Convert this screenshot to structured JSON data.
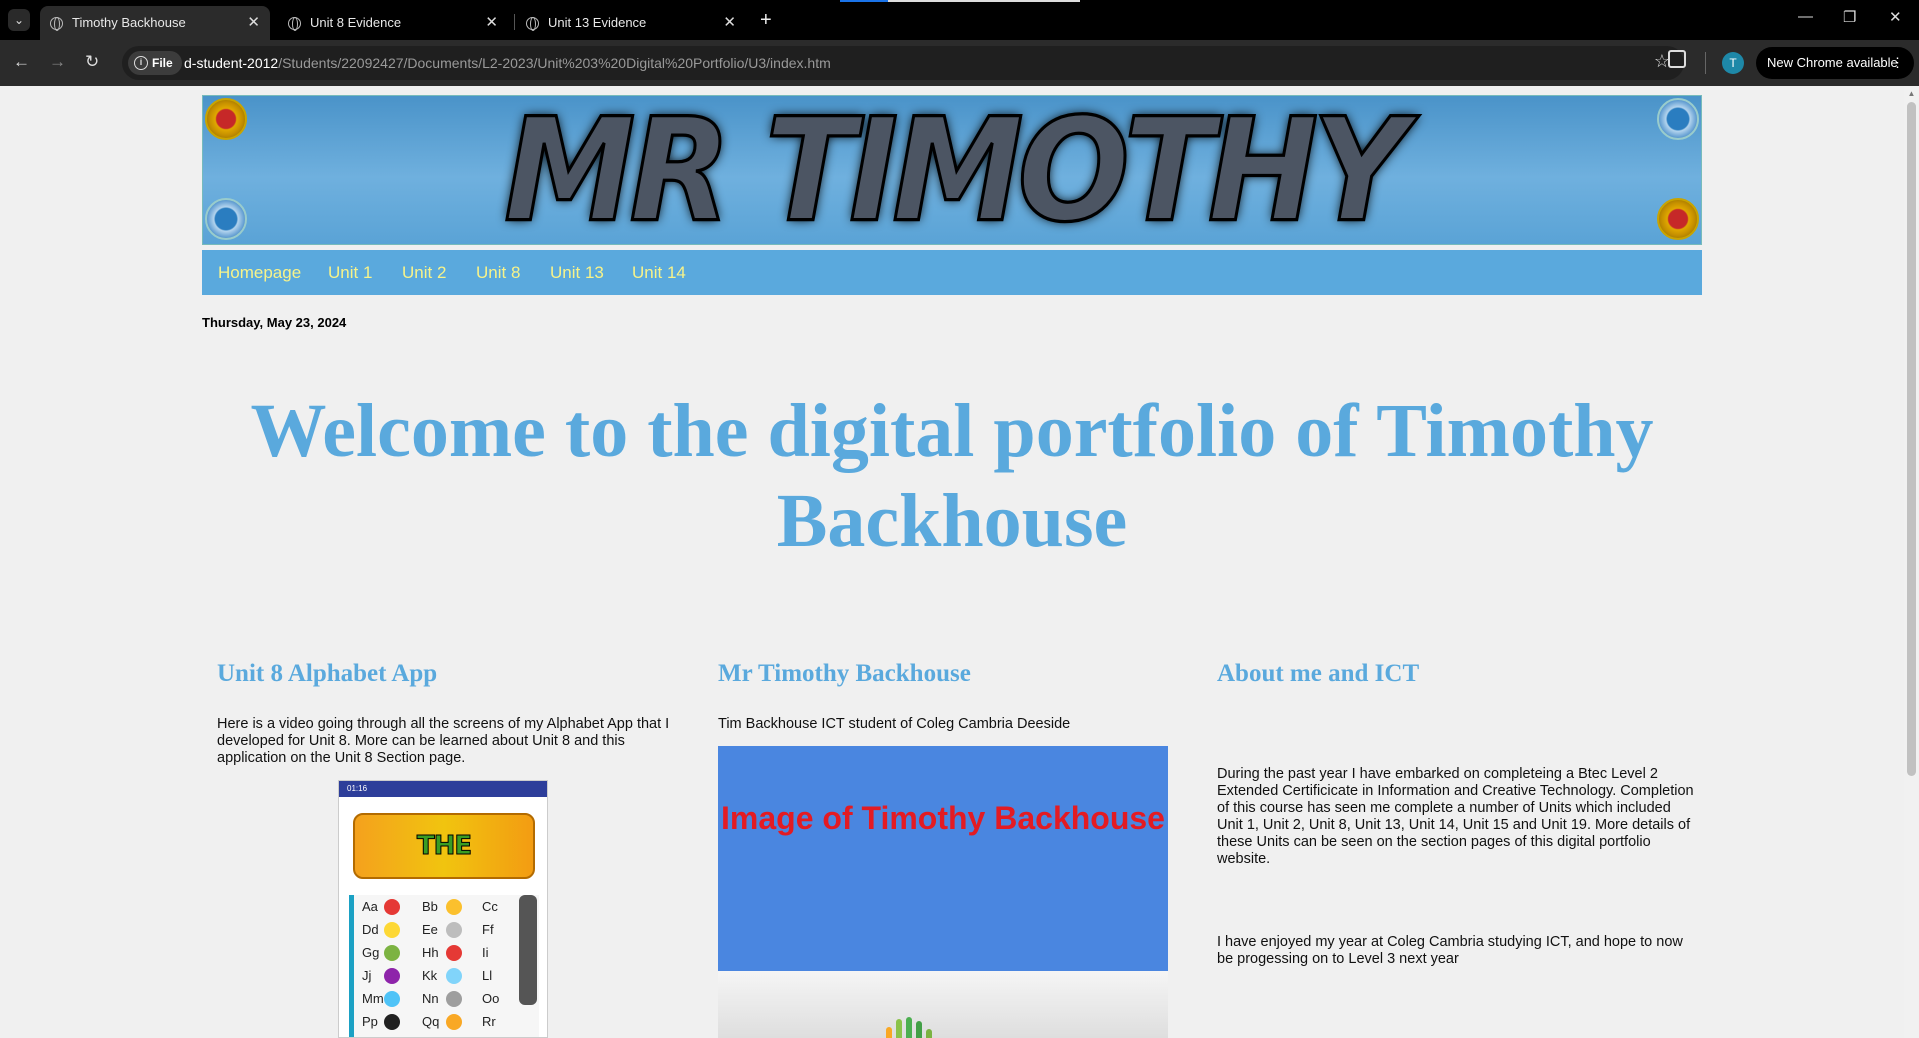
{
  "browser": {
    "tabs": [
      {
        "title": "Timothy Backhouse",
        "active": true
      },
      {
        "title": "Unit 8 Evidence",
        "active": false
      },
      {
        "title": "Unit 13 Evidence",
        "active": false
      }
    ],
    "omnibox": {
      "chip_label": "File",
      "host": "d-student-2012",
      "path": "/Students/22092427/Documents/L2-2023/Unit%203%20Digital%20Portfolio/U3/index.htm"
    },
    "profile_initial": "T",
    "update_label": "New Chrome available",
    "icons": [
      "tab-search-icon",
      "back-icon",
      "forward-icon",
      "reload-icon",
      "info-icon",
      "star-icon",
      "extensions-icon",
      "menu-icon",
      "minimize-icon",
      "restore-icon",
      "close-icon",
      "new-tab-icon"
    ]
  },
  "page": {
    "banner_text": "MR TIMOTHY BACKHOUSE",
    "nav": [
      "Homepage",
      "Unit 1",
      "Unit 2",
      "Unit 8",
      "Unit 13",
      "Unit 14"
    ],
    "date": "Thursday, May 23, 2024",
    "welcome": "Welcome to the digital portfolio of Timothy Backhouse",
    "columns": [
      {
        "heading": "Unit 8 Alphabet App",
        "text": "Here is a video going through all the screens of my Alphabet App that I developed for Unit 8. More can be learned about Unit 8 and this application on the Unit 8 Section page."
      },
      {
        "heading": "Mr Timothy Backhouse",
        "text": "Tim Backhouse ICT student of Coleg Cambria Deeside",
        "image_label": "Image of Timothy Backhouse"
      },
      {
        "heading": "About me and ICT",
        "paragraphs": [
          "During the past year I have embarked on completeing a Btec Level 2 Extended Certificicate in Information and Creative Technology. Completion of this course has seen me complete a number of Units which included Unit 1, Unit 2, Unit 8, Unit 13, Unit 14, Unit 15 and Unit 19. More details of these Units can be seen on the section pages of this digital portfolio website.",
          "I have enjoyed my year at Coleg Cambria studying ICT, and hope to now be progessing on to Level 3 next year"
        ]
      }
    ],
    "app_preview": {
      "logo_text": "THE ALPHABET APP",
      "status_text": "01:16",
      "letters": [
        "Aa",
        "Bb",
        "Cc",
        "Dd",
        "Ee",
        "Ff",
        "Gg",
        "Hh",
        "Ii",
        "Jj",
        "Kk",
        "Ll",
        "Mm",
        "Nn",
        "Oo",
        "Pp",
        "Qq",
        "Rr"
      ]
    }
  }
}
